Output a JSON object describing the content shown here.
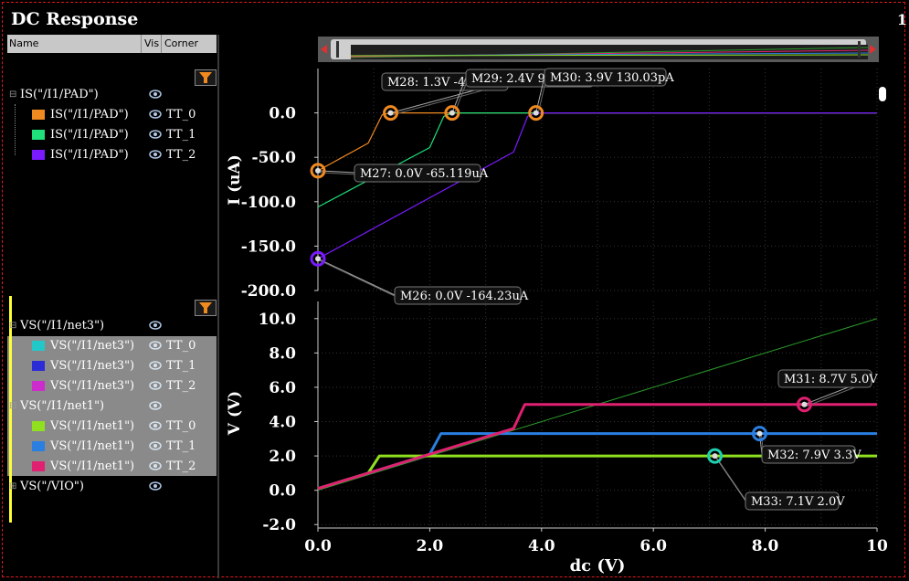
{
  "window": {
    "title": "DC Response",
    "page_number": "1"
  },
  "sidebar": {
    "header": {
      "name": "Name",
      "vis": "Vis",
      "corner": "Corner"
    },
    "groups": [
      {
        "label": "IS(\"/I1/PAD\")",
        "items": [
          {
            "label": "IS(\"/I1/PAD\")",
            "corner": "TT_0",
            "color": "#f08a20"
          },
          {
            "label": "IS(\"/I1/PAD\")",
            "corner": "TT_1",
            "color": "#1fe07a"
          },
          {
            "label": "IS(\"/I1/PAD\")",
            "corner": "TT_2",
            "color": "#7a1aff"
          }
        ]
      },
      {
        "label": "VS(\"/I1/net3\")",
        "items": [
          {
            "label": "VS(\"/I1/net3\")",
            "corner": "TT_0",
            "color": "#22c8c8"
          },
          {
            "label": "VS(\"/I1/net3\")",
            "corner": "TT_1",
            "color": "#2c2cd6"
          },
          {
            "label": "VS(\"/I1/net3\")",
            "corner": "TT_2",
            "color": "#cc2ccc"
          }
        ]
      },
      {
        "label": "VS(\"/I1/net1\")",
        "items": [
          {
            "label": "VS(\"/I1/net1\")",
            "corner": "TT_0",
            "color": "#90e020"
          },
          {
            "label": "VS(\"/I1/net1\")",
            "corner": "TT_1",
            "color": "#2a7fe0"
          },
          {
            "label": "VS(\"/I1/net1\")",
            "corner": "TT_2",
            "color": "#e02070"
          }
        ]
      },
      {
        "label": "VS(\"/VIO\")",
        "items": []
      }
    ]
  },
  "colors": {
    "background": "#000000",
    "grid": "#3a3a3a",
    "accent": "#f08a20"
  },
  "chart_data": [
    {
      "type": "line",
      "ylabel": "I (uA)",
      "ylim": [
        -200,
        50
      ],
      "xlim": [
        0,
        10
      ],
      "yticks": [
        "0.0",
        "-50.0",
        "-100.0",
        "-150.0",
        "-200.0"
      ],
      "grid": true,
      "series": [
        {
          "corner": "TT_0",
          "color": "#f08a20",
          "x": [
            0,
            0.9,
            1.15,
            1.3,
            10
          ],
          "y": [
            -65.1,
            -34,
            -2,
            0,
            0
          ]
        },
        {
          "corner": "TT_1",
          "color": "#1fe07a",
          "x": [
            0,
            2.0,
            2.25,
            2.4,
            10
          ],
          "y": [
            -106,
            -39,
            -4,
            0,
            0
          ]
        },
        {
          "corner": "TT_2",
          "color": "#7a1aff",
          "x": [
            0,
            3.5,
            3.75,
            3.9,
            10
          ],
          "y": [
            -164.2,
            -44,
            -4,
            0,
            0
          ]
        }
      ],
      "markers": [
        {
          "label": "M26: 0.0V -164.23uA",
          "x": 0.0,
          "y": -164.23,
          "color": "#7a1aff"
        },
        {
          "label": "M27: 0.0V -65.119uA",
          "x": 0.0,
          "y": -65.119,
          "color": "#f08a20"
        },
        {
          "label": "M28: 1.3V -46.55nA",
          "x": 1.3,
          "y": 0,
          "color": "#f08a20"
        },
        {
          "label": "M29: 2.4V 94.8pA",
          "x": 2.4,
          "y": 0,
          "color": "#f08a20"
        },
        {
          "label": "M30: 3.9V 130.03pA",
          "x": 3.9,
          "y": 0,
          "color": "#f08a20"
        }
      ]
    },
    {
      "type": "line",
      "ylabel": "V (V)",
      "xlabel": "dc (V)",
      "ylim": [
        -2,
        11
      ],
      "xlim": [
        0,
        10
      ],
      "yticks": [
        "10.0",
        "8.0",
        "6.0",
        "4.0",
        "2.0",
        "0.0",
        "-2.0"
      ],
      "xticks": [
        "0.0",
        "2.0",
        "4.0",
        "6.0",
        "8.0",
        "10"
      ],
      "grid": true,
      "series": [
        {
          "corner": "VIO",
          "color": "#2a9a2a",
          "x": [
            0,
            10
          ],
          "y": [
            0,
            10
          ],
          "thin": true
        },
        {
          "corner": "TT_1",
          "color": "#2a7fe0",
          "x": [
            0,
            2.0,
            2.2,
            10
          ],
          "y": [
            0.1,
            2.1,
            3.3,
            3.3
          ]
        },
        {
          "corner": "TT_0",
          "color": "#90e020",
          "x": [
            0,
            0.9,
            1.1,
            10
          ],
          "y": [
            0.1,
            1.0,
            2.0,
            2.0
          ]
        },
        {
          "corner": "TT_2",
          "color": "#e02070",
          "x": [
            0,
            3.5,
            3.7,
            10
          ],
          "y": [
            0.1,
            3.6,
            5.0,
            5.0
          ]
        }
      ],
      "markers": [
        {
          "label": "M31: 8.7V 5.0V",
          "x": 8.7,
          "y": 5.0,
          "color": "#e02070"
        },
        {
          "label": "M32: 7.9V 3.3V",
          "x": 7.9,
          "y": 3.3,
          "color": "#2a7fe0"
        },
        {
          "label": "M33: 7.1V 2.0V",
          "x": 7.1,
          "y": 2.0,
          "color": "#1fd0b0"
        }
      ]
    }
  ]
}
